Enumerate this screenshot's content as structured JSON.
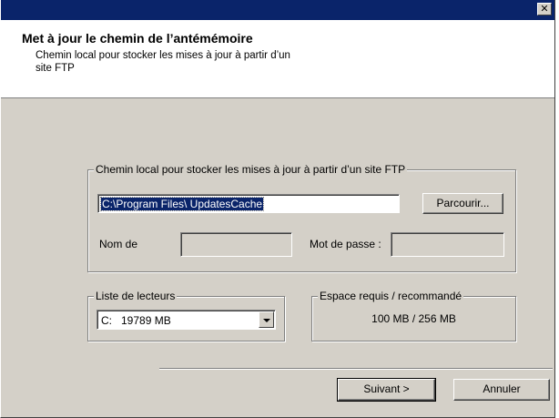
{
  "titlebar": {
    "close_glyph": "✕",
    "close_icon": "close-icon"
  },
  "header": {
    "title": "Met à jour le chemin de l’antémémoire",
    "description_line1": "Chemin local pour stocker les mises à jour à partir d’un",
    "description_line2": "site FTP"
  },
  "ftp_group": {
    "legend": "Chemin local pour stocker les mises à jour à partir d’un site FTP",
    "path_value": "C:\\Program Files\\ UpdatesCache",
    "browse_label": "Parcourir...",
    "username_label": "Nom de",
    "username_value": "",
    "password_label": "Mot de passe :",
    "password_value": ""
  },
  "drives_group": {
    "legend": "Liste de lecteurs",
    "selected_drive": "C:   19789 MB"
  },
  "space_group": {
    "legend": "Espace requis / recommandé",
    "value": "100 MB / 256 MB"
  },
  "footer": {
    "next_label": "Suivant >",
    "cancel_label": "Annuler"
  },
  "colors": {
    "titlebar": "#0a246a",
    "dialog_background": "#d4d0c8",
    "selection": "#0a246a"
  }
}
